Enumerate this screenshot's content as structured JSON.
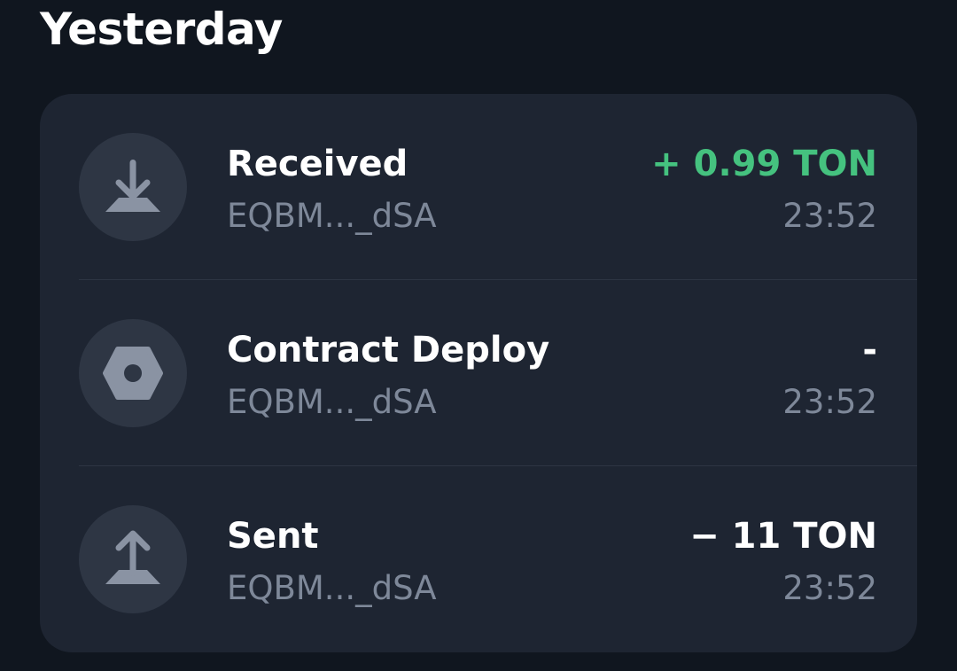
{
  "section": {
    "title": "Yesterday"
  },
  "transactions": [
    {
      "type": "Received",
      "address": "EQBM..._dSA",
      "amount": "+ 0.99 TON",
      "time": "23:52",
      "icon": "arrow-down-icon",
      "amount_color": "#45c27f"
    },
    {
      "type": "Contract Deploy",
      "address": "EQBM..._dSA",
      "amount": "-",
      "time": "23:52",
      "icon": "hexagon-nut-icon",
      "amount_color": "#ffffff"
    },
    {
      "type": "Sent",
      "address": "EQBM..._dSA",
      "amount": "− 11 TON",
      "time": "23:52",
      "icon": "arrow-up-icon",
      "amount_color": "#ffffff"
    }
  ],
  "colors": {
    "background": "#10161f",
    "card": "#1e2532",
    "icon_bg": "#2e3644",
    "icon_fg": "#8a93a3",
    "positive": "#45c27f",
    "secondary_text": "#7e8899"
  }
}
